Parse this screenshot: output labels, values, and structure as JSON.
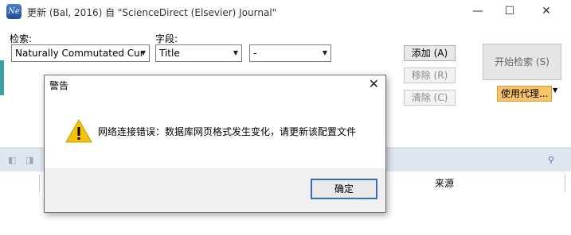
{
  "window": {
    "icon_text": "Ne",
    "title": "更新 (Bal, 2016) 自 \"ScienceDirect (Elsevier) Journal\"",
    "minimize": "—",
    "maximize": "☐",
    "close": "✕"
  },
  "search": {
    "search_label": "检索:",
    "search_value": "Naturally Commutated Cur",
    "field_label": "字段:",
    "field_value": "Title",
    "operator_value": "-"
  },
  "buttons": {
    "add": "添加 (A)",
    "remove": "移除 (R)",
    "clear": "清除 (C)",
    "start_search": "开始检索 (S)",
    "use_proxy": "使用代理..."
  },
  "grid": {
    "columns": [
      "",
      "来源"
    ]
  },
  "dialog": {
    "title": "警告",
    "message": "网络连接错误：数据库网页格式发生变化，请更新该配置文件",
    "ok": "确定"
  },
  "colors": {
    "proxy_bg": "#f7c46a",
    "toolbar_bg": "#dfe7f1",
    "ok_border": "#2e6fc4",
    "warning_yellow": "#f5c400"
  }
}
